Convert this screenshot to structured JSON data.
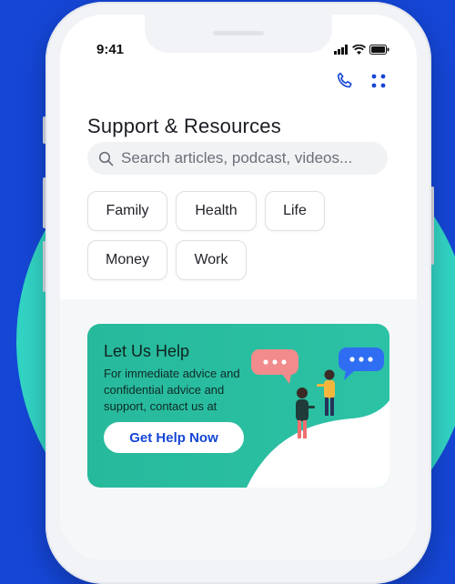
{
  "status_bar": {
    "time": "9:41"
  },
  "header": {
    "title": "Support & Resources"
  },
  "search": {
    "placeholder": "Search articles, podcast, videos..."
  },
  "categories": [
    "Family",
    "Health",
    "Life",
    "Money",
    "Work"
  ],
  "help_card": {
    "title": "Let Us Help",
    "body": "For immediate advice and confidential advice and support, contact us at",
    "button_label": "Get Help Now"
  },
  "colors": {
    "background": "#1546d6",
    "circle": "#32d4c4",
    "card": "#2cc2a5",
    "accent": "#1546d6"
  },
  "icons": [
    "signal-icon",
    "wifi-icon",
    "battery-icon",
    "phone-icon",
    "grid-menu-icon",
    "search-icon",
    "chat-bubble-icon"
  ]
}
